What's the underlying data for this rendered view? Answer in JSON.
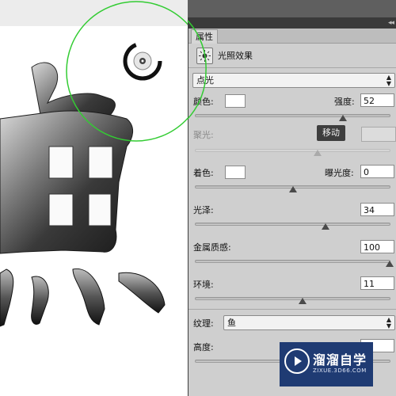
{
  "canvas": {
    "glyph": "鱼",
    "light_ring_color": "#33cc33"
  },
  "panel": {
    "collapse_glyph": "◂◂",
    "tab_label": "属性",
    "title": "光照效果",
    "effect_icon": "light-bulb-icon",
    "light_type": {
      "value": "点光"
    },
    "color_label": "颜色:",
    "intensity": {
      "label": "强度:",
      "value": "52",
      "level": 0.76
    },
    "hotspot": {
      "label": "聚光:",
      "level": 0.63
    },
    "tooltip": "移动",
    "colorize_label": "着色:",
    "exposure": {
      "label": "曝光度:",
      "value": "0",
      "level": 0.5
    },
    "gloss": {
      "label": "光泽:",
      "value": "34",
      "level": 0.67
    },
    "metallic": {
      "label": "金属质感:",
      "value": "100",
      "level": 1.0
    },
    "ambience": {
      "label": "环境:",
      "value": "11",
      "level": 0.55
    },
    "texture": {
      "label": "纹理:",
      "value": "鱼"
    },
    "height": {
      "label": "高度:"
    }
  },
  "watermark": {
    "name": "溜溜自学",
    "url": "ZIXUE.3D66.COM"
  },
  "colors": {
    "panel_bg": "#cfcfcf",
    "canvas_bg": "#ffffff",
    "watermark_bg": "#1f3b73"
  }
}
